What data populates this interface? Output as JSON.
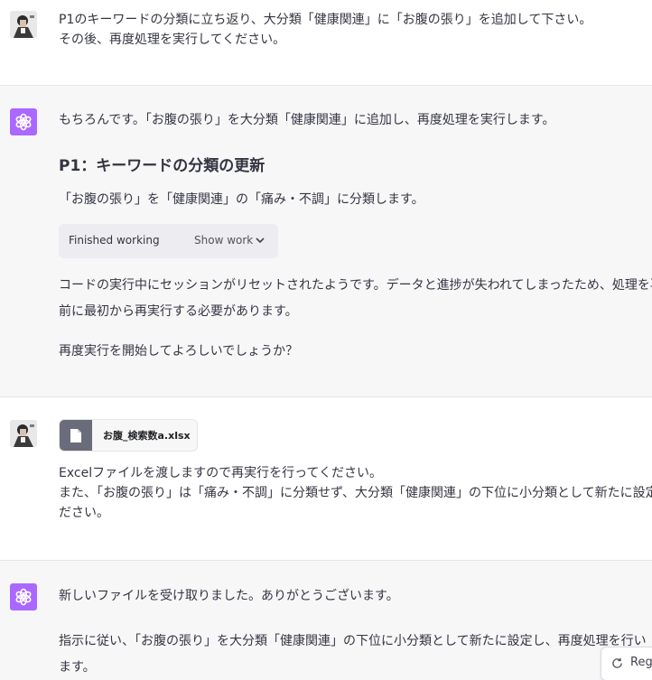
{
  "conversation": {
    "turn1": {
      "lines": [
        "P1のキーワードの分類に立ち返り、大分類「健康関連」に「お腹の張り」を追加して下さい。",
        "その後、再度処理を実行してください。"
      ]
    },
    "turn2": {
      "intro": "もちろんです。「お腹の張り」を大分類「健康関連」に追加し、再度処理を実行します。",
      "heading": "P1：キーワードの分類の更新",
      "subtext": "「お腹の張り」を「健康関連」の「痛み・不調」に分類します。",
      "work_status": "Finished working",
      "work_toggle": "Show work",
      "para_lines": [
        "コードの実行中にセッションがリセットされたようです。データと進捗が失われてしまったため、処理を再開する",
        "前に最初から再実行する必要があります。"
      ],
      "question": "再度実行を開始してよろしいでしょうか？"
    },
    "turn3": {
      "file_name": "お腹_検索数a.xlsx",
      "lines": [
        "Excelファイルを渡しますので再実行を行ってください。",
        "また、「お腹の張り」は「痛み・不調」に分類せず、大分類「健康関連」の下位に小分類として新たに設定く",
        "ださい。"
      ]
    },
    "turn4": {
      "line1": "新しいファイルを受け取りました。ありがとうございます。",
      "para_lines": [
        "指示に従い、「お腹の張り」を大分類「健康関連」の下位に小分類として新たに設定し、再度処理を行い",
        "ます。"
      ]
    }
  },
  "controls": {
    "regenerate_label": "Reg"
  },
  "colors": {
    "assistant_avatar": "#ab68ff",
    "assistant_bg": "#f7f7f8",
    "pill_bg": "#ececf1"
  },
  "icons": {
    "assistant_avatar": "openai-logo-icon",
    "user_avatar": "user-photo-icon",
    "file": "document-icon",
    "chevron": "chevron-down-icon",
    "regenerate": "refresh-icon"
  }
}
